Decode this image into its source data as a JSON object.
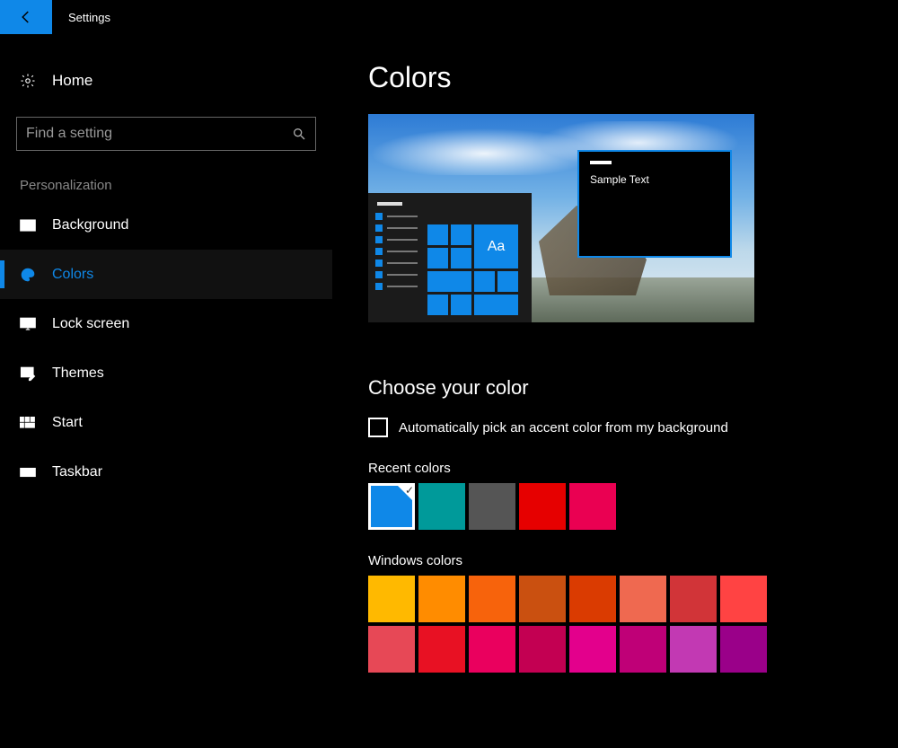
{
  "titlebar": {
    "title": "Settings"
  },
  "sidebar": {
    "home_label": "Home",
    "search_placeholder": "Find a setting",
    "category_label": "Personalization",
    "items": [
      {
        "id": "background",
        "label": "Background",
        "active": false
      },
      {
        "id": "colors",
        "label": "Colors",
        "active": true
      },
      {
        "id": "lock-screen",
        "label": "Lock screen",
        "active": false
      },
      {
        "id": "themes",
        "label": "Themes",
        "active": false
      },
      {
        "id": "start",
        "label": "Start",
        "active": false
      },
      {
        "id": "taskbar",
        "label": "Taskbar",
        "active": false
      }
    ]
  },
  "main": {
    "page_title": "Colors",
    "preview": {
      "tile_text": "Aa",
      "window_text": "Sample Text"
    },
    "choose_section_title": "Choose your color",
    "auto_accent_label": "Automatically pick an accent color from my background",
    "auto_accent_checked": false,
    "recent_colors_label": "Recent colors",
    "recent_colors": [
      {
        "hex": "#0f88e8",
        "selected": true
      },
      {
        "hex": "#009a9a",
        "selected": false
      },
      {
        "hex": "#555555",
        "selected": false
      },
      {
        "hex": "#e60000",
        "selected": false
      },
      {
        "hex": "#ea0052",
        "selected": false
      }
    ],
    "windows_colors_label": "Windows colors",
    "windows_colors": [
      [
        "#ffb900",
        "#ff8c00",
        "#f7630c",
        "#ca5010",
        "#da3b01",
        "#ef6950",
        "#d13438",
        "#ff4343"
      ],
      [
        "#e74856",
        "#e81123",
        "#ea005e",
        "#c30052",
        "#e3008c",
        "#bf0077",
        "#c239b3",
        "#9a0089"
      ]
    ]
  }
}
